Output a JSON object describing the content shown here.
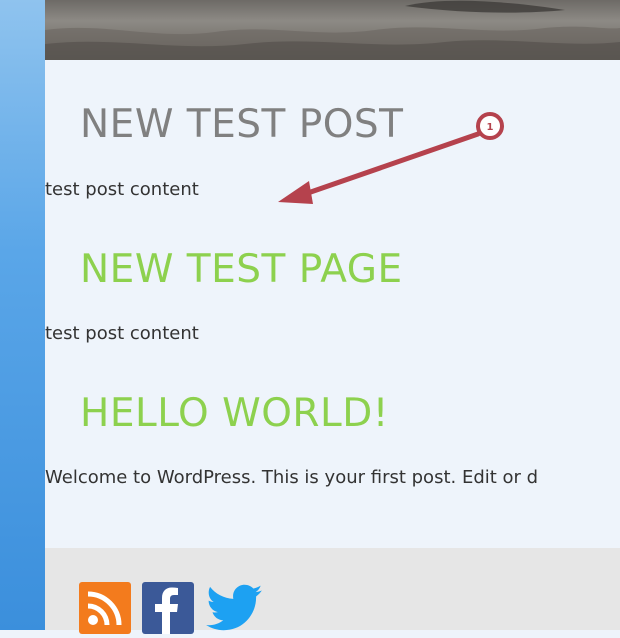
{
  "posts": [
    {
      "title": "NEW TEST POST",
      "body": "test post content"
    },
    {
      "title": "NEW TEST PAGE",
      "body": "test post content"
    },
    {
      "title": "HELLO WORLD!",
      "body": "Welcome to WordPress. This is your first post. Edit or d"
    }
  ],
  "annotation": {
    "number": "1"
  },
  "social": {
    "icons": [
      "rss-icon",
      "facebook-icon",
      "twitter-icon"
    ]
  },
  "colors": {
    "title_gray": "#808080",
    "title_green": "#8dd14e",
    "annotation": "#b5424d",
    "left_bar": "#4a9be4"
  }
}
